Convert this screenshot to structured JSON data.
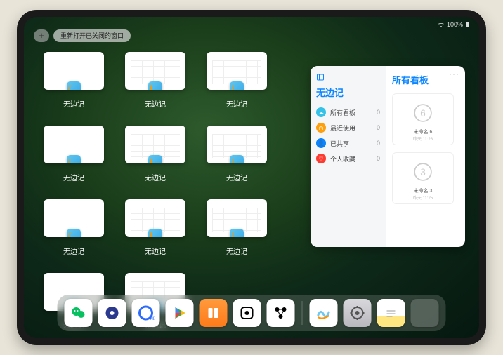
{
  "status": {
    "battery": "100%",
    "wifi": "●●●"
  },
  "top": {
    "plus_label": "+",
    "reopen_label": "重新打开已关闭的窗口"
  },
  "app_tile": {
    "label": "无边记",
    "icon_name": "freeform-icon",
    "total_tiles": 11,
    "blank_thumb_indices": [
      0,
      3,
      6,
      9
    ],
    "grid_thumb_indices": [
      1,
      2,
      4,
      5,
      7,
      8,
      10
    ]
  },
  "panel": {
    "left_title": "无边记",
    "items": [
      {
        "icon_color": "#34c2e8",
        "glyph": "☁",
        "label": "所有看板",
        "count": 0
      },
      {
        "icon_color": "#ff9f0a",
        "glyph": "◷",
        "label": "最近使用",
        "count": 0
      },
      {
        "icon_color": "#0a84ff",
        "glyph": "👤",
        "label": "已共享",
        "count": 0
      },
      {
        "icon_color": "#ff3b30",
        "glyph": "♡",
        "label": "个人收藏",
        "count": 0
      }
    ],
    "right_title": "所有看板",
    "more_glyph": "···",
    "boards": [
      {
        "digit": "6",
        "name": "未命名 6",
        "time": "昨天 11:28"
      },
      {
        "digit": "3",
        "name": "未命名 3",
        "time": "昨天 11:25"
      }
    ]
  },
  "dock": {
    "main": [
      {
        "name": "wechat-icon",
        "class": "i-wechat"
      },
      {
        "name": "quark-icon",
        "class": "i-quark1"
      },
      {
        "name": "quark-hd-icon",
        "class": "i-quark2"
      },
      {
        "name": "play-store-icon",
        "class": "i-play"
      },
      {
        "name": "books-icon",
        "class": "i-books"
      },
      {
        "name": "dot-app-icon",
        "class": "i-dot"
      },
      {
        "name": "graph-app-icon",
        "class": "i-nodes"
      }
    ],
    "recent": [
      {
        "name": "freeform-icon",
        "class": "i-freeform"
      },
      {
        "name": "settings-icon",
        "class": "i-settings"
      },
      {
        "name": "notes-icon",
        "class": "i-notes"
      },
      {
        "name": "app-library-icon",
        "class": "i-recent"
      }
    ]
  }
}
